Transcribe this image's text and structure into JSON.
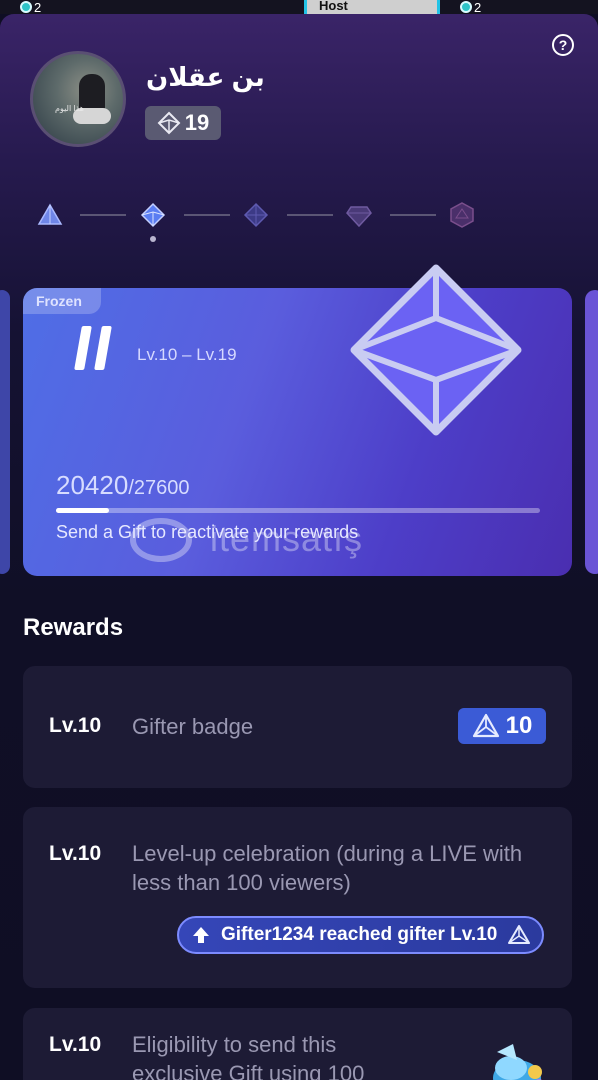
{
  "top_strip": {
    "left_count": "2",
    "host_label": "Host",
    "right_count": "2"
  },
  "header": {
    "help_label": "?",
    "username": "بن عقلان",
    "avatar_caption": "هذا الیوم",
    "level": "19"
  },
  "level_track": {
    "gems": [
      "level-gem-1",
      "level-gem-2",
      "level-gem-3",
      "level-gem-4",
      "level-gem-5"
    ],
    "current_index": 1
  },
  "level_card": {
    "status": "Frozen",
    "tier_numeral": "II",
    "range": "Lv.10 – Lv.19",
    "points_current": "20420",
    "points_total": "/27600",
    "progress_fraction": 0.11,
    "message": "Send a Gift to reactivate your rewards",
    "watermark_text": "itemsatis",
    "colors": {
      "card_start": "#4f6ee6",
      "card_end": "#4a2eb0"
    }
  },
  "rewards": {
    "title": "Rewards",
    "items": [
      {
        "level": "Lv.10",
        "text": "Gifter badge",
        "badge_value": "10"
      },
      {
        "level": "Lv.10",
        "text": "Level-up celebration (during a LIVE with less than 100 viewers)",
        "banner_text": "Gifter1234 reached gifter Lv.10"
      },
      {
        "level": "Lv.10",
        "text": "Eligibility to send this exclusive Gift using 100"
      }
    ]
  }
}
